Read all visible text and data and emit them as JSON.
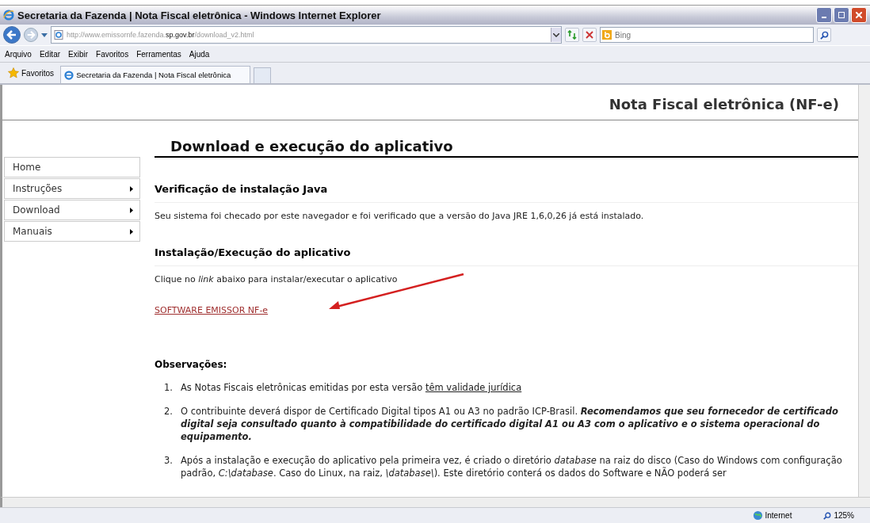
{
  "window": {
    "title": "Secretaria da Fazenda | Nota Fiscal eletrônica - Windows Internet Explorer"
  },
  "address": {
    "prefix": "http://www.emissornfe.fazenda.",
    "domain": "sp.gov.br",
    "path": "/download_v2.html"
  },
  "search": {
    "placeholder": "Bing"
  },
  "menu": [
    "Arquivo",
    "Editar",
    "Exibir",
    "Favoritos",
    "Ferramentas",
    "Ajuda"
  ],
  "favorites": {
    "label": "Favoritos"
  },
  "tabs": [
    {
      "label": "Secretaria da Fazenda | Nota Fiscal eletrônica",
      "selected": true
    }
  ],
  "page": {
    "brand": "Nota Fiscal eletrônica (NF-e)",
    "heading": "Download e execução do aplicativo",
    "sidebar": [
      {
        "label": "Home",
        "submenu": false
      },
      {
        "label": "Instruções",
        "submenu": true
      },
      {
        "label": "Download",
        "submenu": true
      },
      {
        "label": "Manuais",
        "submenu": true
      }
    ],
    "sections": [
      {
        "title": "Verificação de instalação Java",
        "text": "Seu sistema foi checado por este navegador e foi verificado que a versão do Java JRE 1,6,0,26 já está instalado."
      },
      {
        "title": "Instalação/Execução do aplicativo",
        "text": "Clique no *link* abaixo para instalar/executar o aplicativo",
        "link": "SOFTWARE EMISSOR NF-e"
      }
    ],
    "notes_title": "Observações:",
    "notes": [
      {
        "number": "1.",
        "text": "As Notas Fiscais eletrônicas emitidas por esta versão",
        "link": "têm validade jurídica"
      },
      {
        "number": "2.",
        "text": "O contribuinte deverá dispor de Certificado Digital tipos A1 ou A3 no padrão ICP-Brasil.",
        "emphasis": "Recomendamos que seu fornecedor de certificado digital seja consultado quanto à compatibilidade do certificado digital A1 ou A3 com o aplicativo e o sistema operacional do equipamento."
      },
      {
        "number": "3.",
        "text": "Após a instalação e execução do aplicativo pela primeira vez, é criado o diretório *database* na raiz do disco (Caso do Windows com configuração padrão, *C:\\database*. Caso do Linux, na raiz, *\\database\\*). Este diretório conterá os dados do Software e NÃO poderá ser"
      }
    ]
  },
  "status_bar": {
    "zone": "Internet",
    "zoom": "125%"
  }
}
